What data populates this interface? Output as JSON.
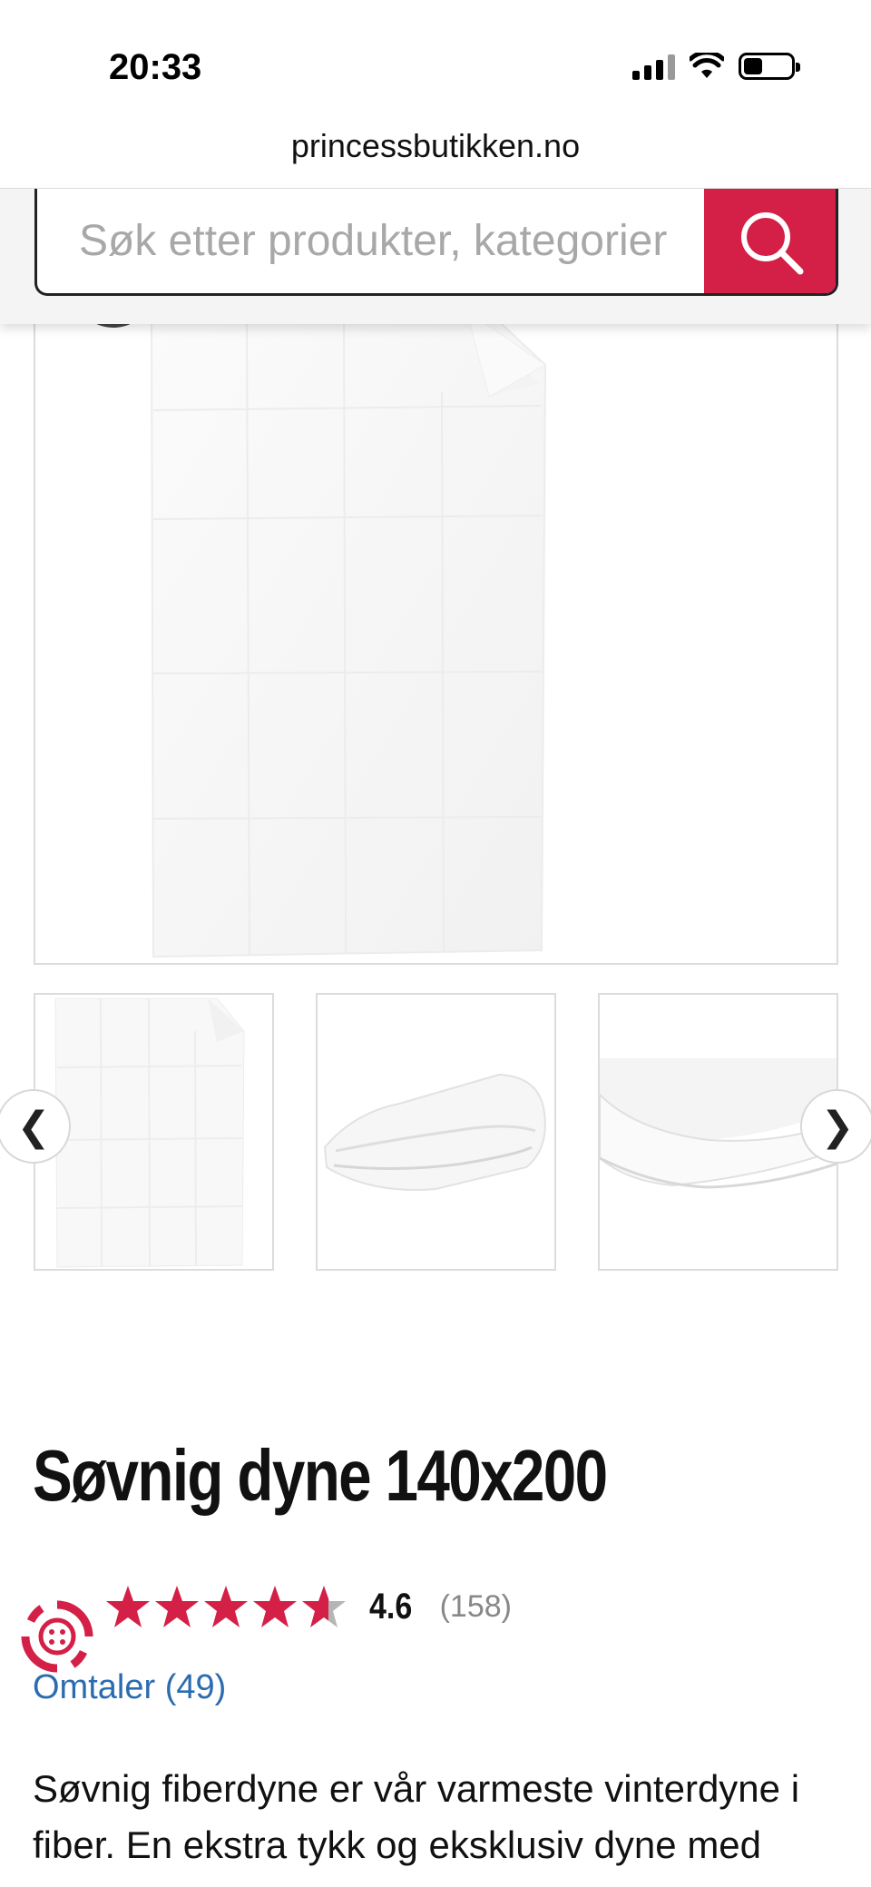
{
  "status": {
    "time": "20:33"
  },
  "browser": {
    "url": "princessbutikken.no"
  },
  "search": {
    "placeholder": "Søk etter produkter, kategorier"
  },
  "gallery": {
    "prev_label": "❮",
    "next_label": "❯",
    "thumbnails": [
      "duvet-flat",
      "duvet-folded",
      "duvet-edge"
    ]
  },
  "product": {
    "title": "Søvnig dyne 140x200",
    "rating": "4.6",
    "rating_count": "(158)",
    "rating_stars": 4.6,
    "reviews_link": "Omtaler (49)",
    "description": "Søvnig fiberdyne er vår varmeste vinterdyne i fiber. En ekstra tykk og eksklusiv dyne med"
  },
  "colors": {
    "accent": "#d41f46",
    "link": "#2b6cb0",
    "star": "#d41f46",
    "star_empty": "#b5b5b5"
  }
}
